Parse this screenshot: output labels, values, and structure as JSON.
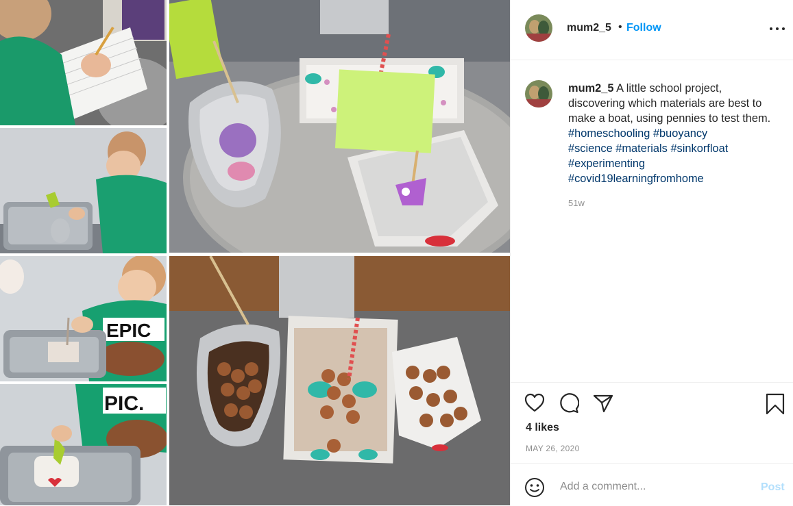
{
  "header": {
    "username": "mum2_5",
    "dot": "•",
    "follow_label": "Follow",
    "more_icon": "more-horizontal-icon"
  },
  "caption": {
    "username": "mum2_5",
    "text": " A little school project, discovering which materials are best to make a boat, using pennies to test them. ",
    "hashtags": [
      "#homeschooling",
      "#buoyancy",
      "#science",
      "#materials",
      "#sinkorfloat",
      "#experimenting",
      "#covid19learningfromhome"
    ],
    "age": "51w"
  },
  "actions": {
    "like_icon": "heart-icon",
    "comment_icon": "comment-icon",
    "share_icon": "paper-plane-icon",
    "save_icon": "bookmark-icon"
  },
  "likes": "4 likes",
  "date": "MAY 26, 2020",
  "comment": {
    "emoji_icon": "smiley-icon",
    "placeholder": "Add a comment...",
    "post_label": "Post"
  },
  "colors": {
    "accent": "#0095f6",
    "post_disabled": "#b2dffc",
    "hashtag": "#00376b",
    "muted": "#8e8e8e",
    "divider": "#efefef"
  }
}
